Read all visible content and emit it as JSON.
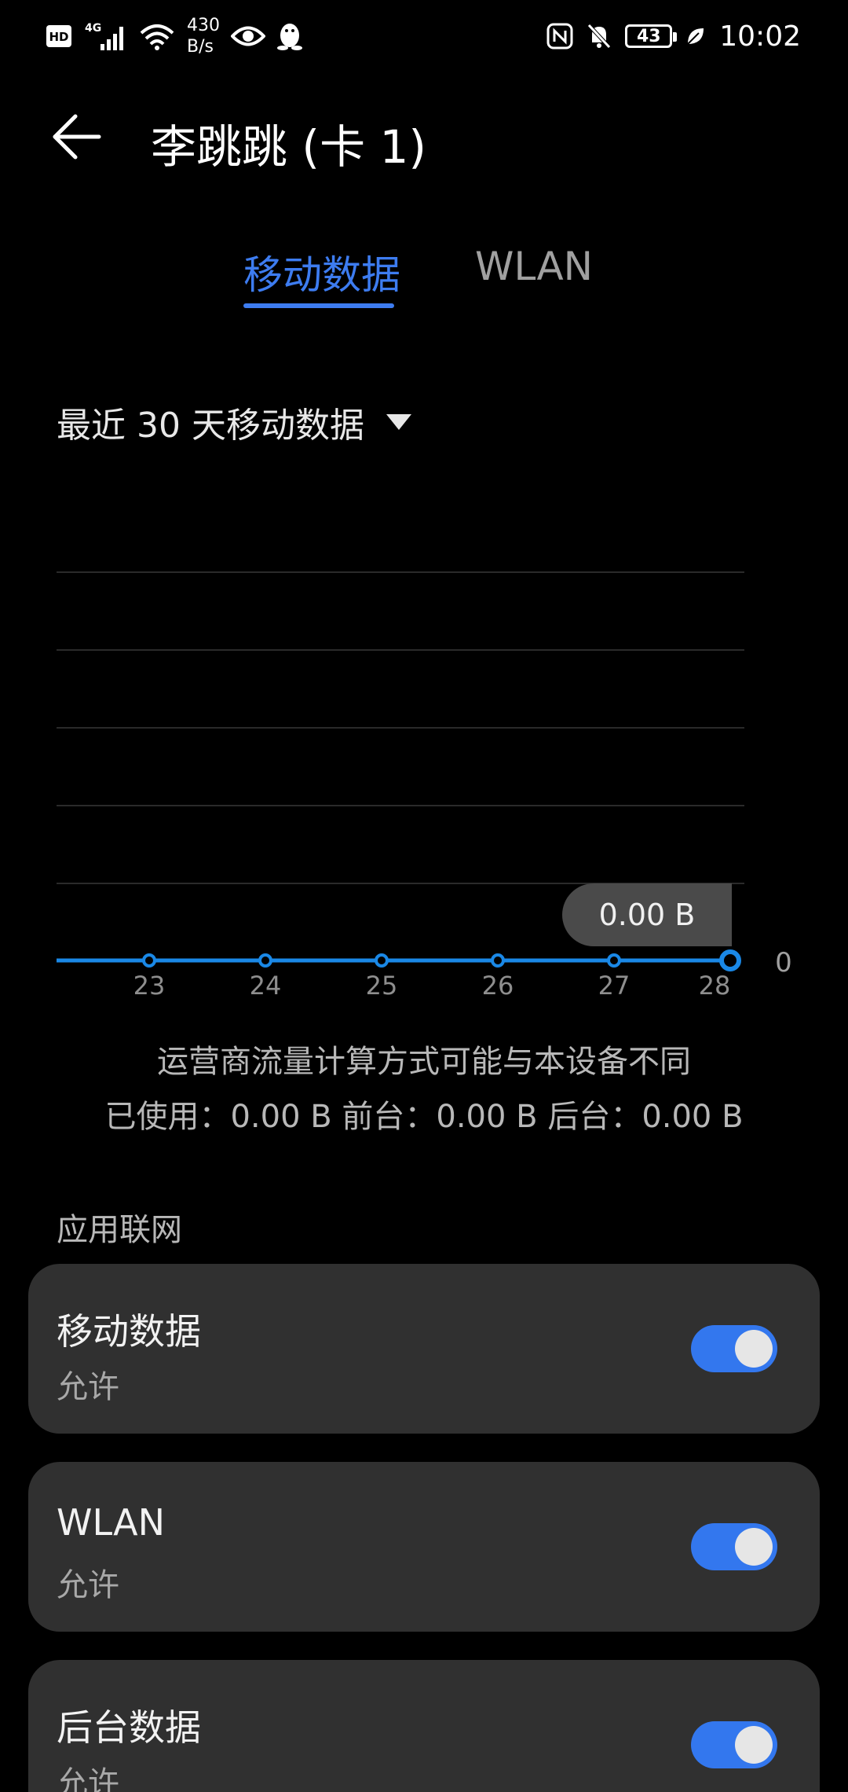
{
  "status_bar": {
    "hd": "HD",
    "network": "4G",
    "net_speed_value": "430",
    "net_speed_unit": "B/s",
    "battery": "43",
    "time": "10:02"
  },
  "header": {
    "title": "李跳跳 (卡 1)"
  },
  "tabs": [
    {
      "label": "移动数据",
      "active": true
    },
    {
      "label": "WLAN",
      "active": false
    }
  ],
  "period": {
    "label": "最近 30 天移动数据"
  },
  "chart_data": {
    "type": "line",
    "x": [
      "23",
      "24",
      "25",
      "26",
      "27",
      "28"
    ],
    "series": [
      {
        "values": [
          0,
          0,
          0,
          0,
          0,
          0
        ]
      }
    ],
    "y_tick_label": "0",
    "tooltip": "0.00 B",
    "grid": true,
    "accent": "#1a88e6"
  },
  "notes": {
    "line1": "运营商流量计算方式可能与本设备不同",
    "line2": "已使用：0.00 B 前台：0.00 B 后台：0.00 B"
  },
  "section": {
    "title": "应用联网"
  },
  "cards": [
    {
      "title": "移动数据",
      "subtitle": "允许",
      "enabled": true
    },
    {
      "title": "WLAN",
      "subtitle": "允许",
      "enabled": true
    },
    {
      "title": "后台数据",
      "subtitle": "允许",
      "enabled": true
    }
  ],
  "colors": {
    "accent": "#3d7cf0",
    "toggle_on": "#3377ee",
    "card_bg": "#303030"
  }
}
